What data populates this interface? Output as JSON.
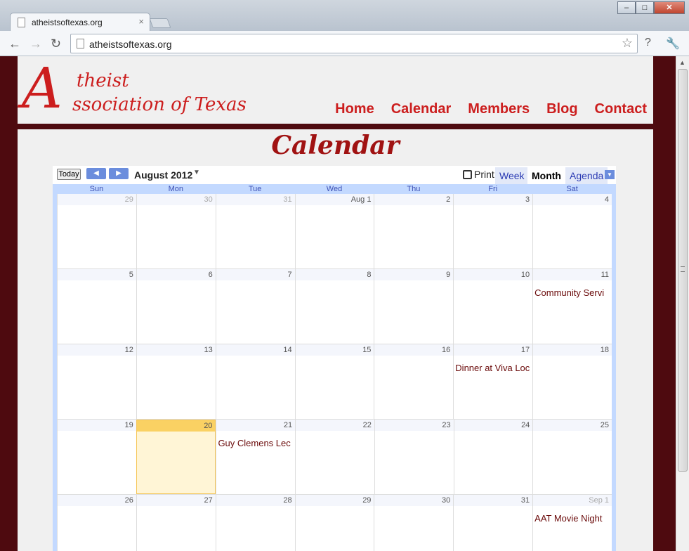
{
  "browser": {
    "tab_title": "atheistsoftexas.org",
    "tab_close": "×",
    "url": "atheistsoftexas.org",
    "buttons": {
      "back": "←",
      "forward": "→",
      "reload": "↻",
      "star": "☆",
      "page": "?",
      "wrench": "🔧"
    },
    "window": {
      "minimize": "–",
      "maximize": "□",
      "close": "✕"
    }
  },
  "site": {
    "logo": {
      "big_letter": "A",
      "line1": "theist",
      "line2": "ssociation of Texas"
    },
    "nav": [
      "Home",
      "Calendar",
      "Members",
      "Blog",
      "Contact"
    ],
    "page_heading": "Calendar"
  },
  "calendar": {
    "today_label": "Today",
    "prev": "◀",
    "next": "▶",
    "month_title": "August 2012",
    "month_dropdown": "▼",
    "print_label": "Print",
    "views": [
      "Week",
      "Month",
      "Agenda"
    ],
    "active_view": "Month",
    "view_dropdown": "▼",
    "days_of_week": [
      "Sun",
      "Mon",
      "Tue",
      "Wed",
      "Thu",
      "Fri",
      "Sat"
    ],
    "weeks": [
      [
        {
          "label": "29",
          "other": true
        },
        {
          "label": "30",
          "other": true
        },
        {
          "label": "31",
          "other": true
        },
        {
          "label": "Aug 1"
        },
        {
          "label": "2"
        },
        {
          "label": "3"
        },
        {
          "label": "4"
        }
      ],
      [
        {
          "label": "5"
        },
        {
          "label": "6"
        },
        {
          "label": "7"
        },
        {
          "label": "8"
        },
        {
          "label": "9"
        },
        {
          "label": "10"
        },
        {
          "label": "11",
          "event": "Community Servi"
        }
      ],
      [
        {
          "label": "12"
        },
        {
          "label": "13"
        },
        {
          "label": "14"
        },
        {
          "label": "15"
        },
        {
          "label": "16"
        },
        {
          "label": "17",
          "event": "Dinner at Viva Loc"
        },
        {
          "label": "18"
        }
      ],
      [
        {
          "label": "19"
        },
        {
          "label": "20",
          "today": true
        },
        {
          "label": "21",
          "event": "Guy Clemens Lec"
        },
        {
          "label": "22"
        },
        {
          "label": "23"
        },
        {
          "label": "24"
        },
        {
          "label": "25"
        }
      ],
      [
        {
          "label": "26"
        },
        {
          "label": "27"
        },
        {
          "label": "28"
        },
        {
          "label": "29"
        },
        {
          "label": "30"
        },
        {
          "label": "31"
        },
        {
          "label": "Sep 1",
          "other": true,
          "event": "AAT Movie Night"
        }
      ]
    ]
  }
}
